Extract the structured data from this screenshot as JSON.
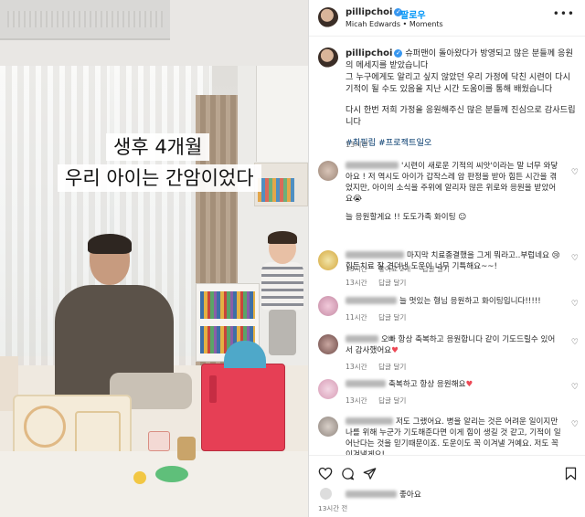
{
  "photo": {
    "caption_top": "생후 4개월",
    "caption_bottom": "우리 아이는 간암이었다"
  },
  "post": {
    "username": "pillipchoi",
    "follow_label": "팔로우",
    "subtitle": "Micah Edwards • Moments",
    "more_icon": "more-horizontal-icon",
    "caption": {
      "username": "pillipchoi",
      "line1": "슈퍼맨이 돌아왔다가 방영되고 많은 분들께 응원의 메세지를 받았습니다",
      "line2": "그 누구에게도 알리고 싶지 않았던 우리 가정에 닥친 시련이 다시 기적이 될 수도 있음을 지난 시간 도움이를 통해 배웠습니다",
      "line3": "다시 한번 저희 가정을 응원해주신 많은 분들께 진심으로 감사드립니다",
      "tags": "#최필립 #프로젝트일오",
      "time": "13시간"
    },
    "comments": [
      {
        "text": "'시련이 새로운 기적의 씨앗'이라는 말 너무 와닿아요 ! 저 역시도 아이가 갑작스레 암 판정을 받아 힘든 시간을 겪었지만, 아이의 소식을 주위에 알리자 많은 위로와 응원을 받았어요😭",
        "text2": "늘 응원할게요 !! 도도가족 화이팅 ☺",
        "time": "13시간",
        "likes": "좋아요 2개",
        "reply": "답글 달기"
      },
      {
        "text": "마지막 치료종결했을 그게 뭐라고..부럽네요 😢힘든치료 잘 견뎌낸 도운이 너무 기특해요~~!",
        "time": "13시간",
        "reply": "답글 달기"
      },
      {
        "text": "늘 멋있는 형님 응원하고 화이팅입니다!!!!!",
        "time": "11시간",
        "reply": "답글 달기"
      },
      {
        "text": "오빠 항상 축복하고 응원합니다 같이 기도드릴수 있어서 감사했어요",
        "time": "13시간",
        "reply": "답글 달기"
      },
      {
        "text": "축복하고 항상 응원해요",
        "time": "13시간",
        "reply": "답글 달기"
      },
      {
        "text": "저도 그랬어요. 병을 알리는 것은 어려운 일이지만 나를 위해 누군가 기도해준다면 이게 힘이 생길 것 같고, 기적이 일어난다는 것을 믿기때문이죠. 도운이도 꼭 이겨낼 거예요. 저도 꼭 이겨낼게요!",
        "time": "",
        "reply": ""
      }
    ],
    "actions": {
      "like_icon": "heart-icon",
      "comment_icon": "comment-icon",
      "share_icon": "share-icon",
      "save_icon": "bookmark-icon",
      "likes_text": "좋아요",
      "time": "13시간 전"
    }
  }
}
